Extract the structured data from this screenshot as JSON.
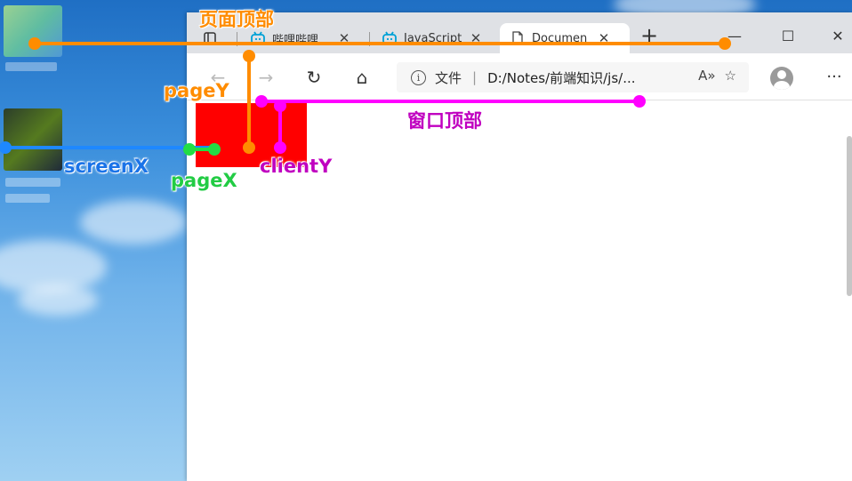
{
  "tabs": [
    {
      "title": "哔哩哔哩",
      "icon": "bilibili-icon",
      "close": "✕"
    },
    {
      "title": "JavaScript",
      "icon": "bilibili-icon",
      "close": "✕"
    },
    {
      "title": "Documen",
      "icon": "document-icon",
      "close": "✕",
      "active": true
    }
  ],
  "new_tab": "+",
  "window_controls": {
    "minimize": "—",
    "maximize": "☐",
    "close": "✕"
  },
  "toolbar": {
    "back": "←",
    "forward": "→",
    "refresh": "↻",
    "home": "⌂",
    "more": "···"
  },
  "address": {
    "info": "i",
    "scheme_label": "文件",
    "separator": "|",
    "url": "D:/Notes/前端知识/js/...",
    "read_aloud": "A»",
    "favorites": "☆"
  },
  "annotations": {
    "page_top": "页面顶部",
    "window_top": "窗口顶部",
    "pageY": "pageY",
    "pageX": "pageX",
    "screenX": "screenX",
    "clientY": "clientY"
  },
  "colors": {
    "orange": "#ff8c00",
    "magenta": "#ff00ff",
    "blue": "#1e88ff",
    "green": "#22dd44",
    "red_box": "#ff0000",
    "text_blue": "#1a73e8",
    "text_purple": "#c000c0"
  }
}
